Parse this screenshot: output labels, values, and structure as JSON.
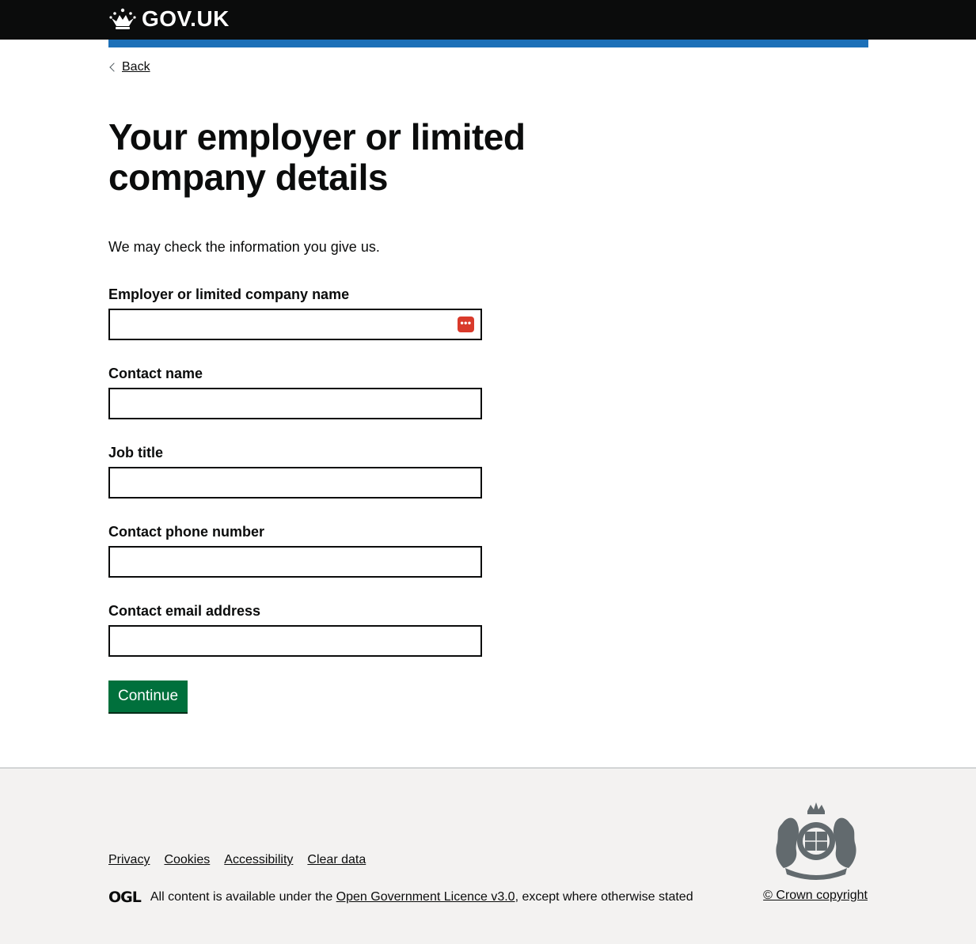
{
  "header": {
    "brand": "GOV.UK",
    "crown_icon": "crown-icon",
    "colors": {
      "bar": "#0b0c0c",
      "accent": "#1d70b8"
    }
  },
  "navigation": {
    "back_label": "Back",
    "back_icon": "chevron-left-icon"
  },
  "page": {
    "title": "Your employer or limited company details",
    "lede": "We may check the information you give us."
  },
  "form": {
    "fields": [
      {
        "label": "Employer or limited company name",
        "value": ""
      },
      {
        "label": "Contact name",
        "value": ""
      },
      {
        "label": "Job title",
        "value": ""
      },
      {
        "label": "Contact phone number",
        "value": ""
      },
      {
        "label": "Contact email address",
        "value": ""
      }
    ],
    "autofill_icon": "autofill-dots-icon",
    "submit_label": "Continue",
    "colors": {
      "button": "#00703c",
      "autofill": "#d93a2b"
    }
  },
  "footer": {
    "links": [
      "Privacy",
      "Cookies",
      "Accessibility",
      "Clear data"
    ],
    "ogl_logo": "OGL",
    "licence_prefix": "All content is available under the ",
    "licence_link": "Open Government Licence v3.0",
    "licence_suffix": ", except where otherwise stated",
    "crest_icon": "royal-coat-of-arms-icon",
    "copyright": "© Crown copyright"
  }
}
